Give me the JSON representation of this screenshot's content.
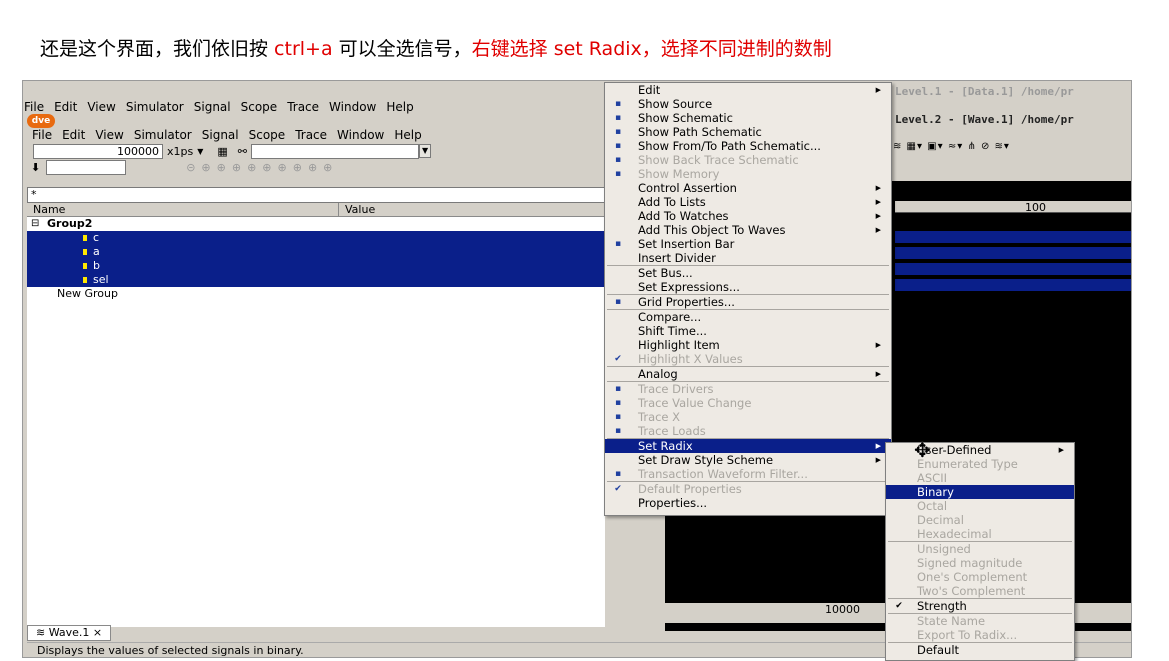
{
  "caption": {
    "part1": "还是这个界面，我们依旧按 ",
    "part2": "ctrl+a",
    "part3": " 可以全选信号，",
    "part4": "右键选择 set Radix，选择不同进制的数制"
  },
  "window": {
    "title_top": "Level.1 - [Data.1]  /home/pr",
    "title_wave": "Level.2 - [Wave.1]  /home/pr",
    "logo": "dve"
  },
  "menubar_outer": [
    "File",
    "Edit",
    "View",
    "Simulator",
    "Signal",
    "Scope",
    "Trace",
    "Window",
    "Help"
  ],
  "menubar_inner": [
    "File",
    "Edit",
    "View",
    "Simulator",
    "Signal",
    "Scope",
    "Trace",
    "Window",
    "Help"
  ],
  "toolbar": {
    "time_value": "100000",
    "time_unit": "x1ps"
  },
  "filter": {
    "value": "*"
  },
  "grid_headers": [
    "Name",
    "Value"
  ],
  "tree": [
    {
      "label": "Group2",
      "selected": false,
      "bold": true
    },
    {
      "label": "c",
      "selected": true
    },
    {
      "label": "a",
      "selected": true
    },
    {
      "label": "b",
      "selected": true
    },
    {
      "label": "sel",
      "selected": true
    },
    {
      "label": "New Group",
      "selected": false
    }
  ],
  "wave": {
    "ruler_top": "100",
    "ruler_bottom": "10000"
  },
  "tab": {
    "label": "Wave.1"
  },
  "status": {
    "text": "Displays the values of selected signals in binary."
  },
  "context_menu": {
    "items": [
      {
        "label": "Edit",
        "sub": true
      },
      {
        "label": "Show Source",
        "icon": "source-icon"
      },
      {
        "label": "Show Schematic",
        "icon": "schematic-icon"
      },
      {
        "label": "Show Path Schematic",
        "icon": "path-schematic-icon"
      },
      {
        "label": "Show From/To Path Schematic...",
        "icon": "fromto-icon"
      },
      {
        "label": "Show Back Trace Schematic",
        "disabled": true,
        "icon": "backtrace-icon"
      },
      {
        "label": "Show Memory",
        "disabled": true,
        "icon": "memory-icon"
      },
      {
        "label": "Control Assertion",
        "sub": true
      },
      {
        "label": "Add To Lists",
        "sub": true
      },
      {
        "label": "Add To Watches",
        "sub": true
      },
      {
        "label": "Add This Object To Waves",
        "sub": true
      },
      {
        "label": "Set Insertion Bar",
        "icon": "insertion-icon"
      },
      {
        "label": "Insert Divider",
        "sep_after": true
      },
      {
        "label": "Set Bus..."
      },
      {
        "label": "Set Expressions...",
        "sep_after": true
      },
      {
        "label": "Grid Properties...",
        "icon": "grid-icon",
        "sep_after": true
      },
      {
        "label": "Compare..."
      },
      {
        "label": "Shift Time..."
      },
      {
        "label": "Highlight Item",
        "sub": true
      },
      {
        "label": "Highlight X Values",
        "disabled": true,
        "icon": "check-icon",
        "sep_after": true
      },
      {
        "label": "Analog",
        "sub": true,
        "sep_after": true
      },
      {
        "label": "Trace Drivers",
        "disabled": true,
        "icon": "drivers-icon"
      },
      {
        "label": "Trace Value Change",
        "disabled": true,
        "icon": "value-change-icon"
      },
      {
        "label": "Trace X",
        "disabled": true,
        "icon": "trace-x-icon"
      },
      {
        "label": "Trace Loads",
        "disabled": true,
        "icon": "loads-icon",
        "sep_after": true
      },
      {
        "label": "Set Radix",
        "sub": true,
        "highlighted": true
      },
      {
        "label": "Set Draw Style Scheme",
        "sub": true
      },
      {
        "label": "Transaction Waveform Filter...",
        "disabled": true,
        "icon": "filter-icon",
        "sep_after": true
      },
      {
        "label": "Default Properties",
        "disabled": true,
        "icon": "check-icon"
      },
      {
        "label": "Properties..."
      }
    ]
  },
  "radix_menu": {
    "items": [
      {
        "label": "User-Defined",
        "sub": true
      },
      {
        "label": "Enumerated Type",
        "disabled": true
      },
      {
        "label": "ASCII",
        "disabled": true
      },
      {
        "label": "Binary",
        "highlighted": true
      },
      {
        "label": "Octal",
        "disabled": true
      },
      {
        "label": "Decimal",
        "disabled": true
      },
      {
        "label": "Hexadecimal",
        "disabled": true,
        "sep_after": true
      },
      {
        "label": "Unsigned",
        "disabled": true
      },
      {
        "label": "Signed magnitude",
        "disabled": true
      },
      {
        "label": "One's Complement",
        "disabled": true
      },
      {
        "label": "Two's Complement",
        "disabled": true,
        "sep_after": true
      },
      {
        "label": "Strength",
        "checked": true,
        "sep_after": true
      },
      {
        "label": "State Name",
        "disabled": true
      },
      {
        "label": "Export To Radix...",
        "disabled": true,
        "sep_after": true
      },
      {
        "label": "Default"
      }
    ]
  }
}
